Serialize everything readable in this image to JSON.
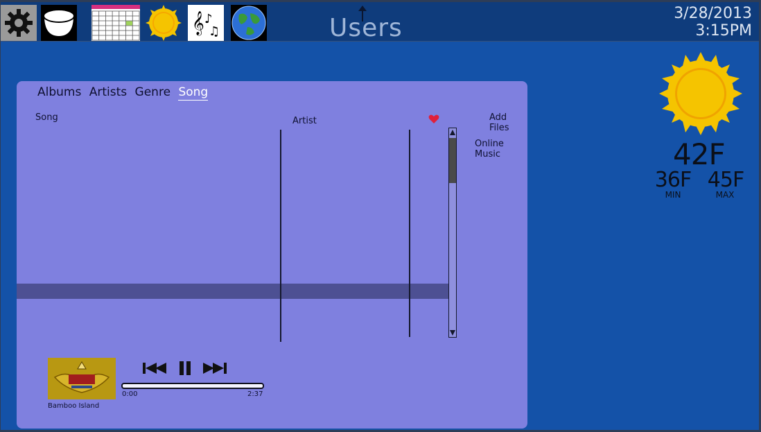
{
  "topbar": {
    "apps": [
      {
        "name": "settings-gear-icon"
      },
      {
        "name": "bowl-icon"
      },
      {
        "name": "calendar-icon"
      },
      {
        "name": "weather-sun-icon"
      },
      {
        "name": "music-notes-icon"
      },
      {
        "name": "globe-icon"
      }
    ],
    "users_label": "Users",
    "date": "3/28/2013",
    "time": "3:15PM"
  },
  "weather": {
    "icon": "sun-icon",
    "current": "42F",
    "min": "36F",
    "min_label": "MIN",
    "max": "45F",
    "max_label": "MAX"
  },
  "music": {
    "tabs": [
      "Albums",
      "Artists",
      "Genre",
      "Song"
    ],
    "active_tab": "Song",
    "columns": {
      "song": "Song",
      "artist": "Artist"
    },
    "links": {
      "add_files": "Add Files",
      "online_music": "Online Music"
    },
    "now_playing": {
      "title": "Bamboo Island",
      "elapsed": "0:00",
      "duration": "2:37",
      "progress": 0.0
    }
  }
}
